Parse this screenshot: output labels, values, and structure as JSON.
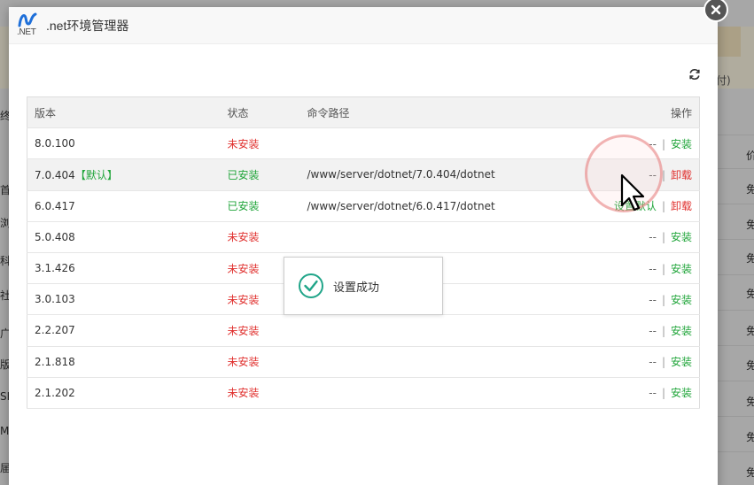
{
  "modal": {
    "title": ".net环境管理器",
    "logo_text": ".NET"
  },
  "background": {
    "paren_text": "付)",
    "left_chars": [
      "终",
      "首",
      "浏",
      "科",
      "社",
      "广",
      "版",
      "SF",
      "M",
      "届"
    ],
    "right_header": "价",
    "right_chars": [
      "免",
      "免",
      "免",
      "免",
      "免",
      "免",
      "免",
      "免",
      "免"
    ]
  },
  "table": {
    "headers": {
      "version": "版本",
      "status": "状态",
      "path": "命令路径",
      "action": "操作"
    },
    "rows": [
      {
        "version": "8.0.100",
        "default_tag": "",
        "status": "未安装",
        "installed": false,
        "path": "",
        "left_action": "--",
        "right_action": "安装"
      },
      {
        "version": "7.0.404",
        "default_tag": "【默认】",
        "status": "已安装",
        "installed": true,
        "path": "/www/server/dotnet/7.0.404/dotnet",
        "left_action": "--",
        "right_action": "卸载"
      },
      {
        "version": "6.0.417",
        "default_tag": "",
        "status": "已安装",
        "installed": true,
        "path": "/www/server/dotnet/6.0.417/dotnet",
        "left_action": "设置默认",
        "right_action": "卸载"
      },
      {
        "version": "5.0.408",
        "default_tag": "",
        "status": "未安装",
        "installed": false,
        "path": "",
        "left_action": "--",
        "right_action": "安装"
      },
      {
        "version": "3.1.426",
        "default_tag": "",
        "status": "未安装",
        "installed": false,
        "path": "",
        "left_action": "--",
        "right_action": "安装"
      },
      {
        "version": "3.0.103",
        "default_tag": "",
        "status": "未安装",
        "installed": false,
        "path": "",
        "left_action": "--",
        "right_action": "安装"
      },
      {
        "version": "2.2.207",
        "default_tag": "",
        "status": "未安装",
        "installed": false,
        "path": "",
        "left_action": "--",
        "right_action": "安装"
      },
      {
        "version": "2.1.818",
        "default_tag": "",
        "status": "未安装",
        "installed": false,
        "path": "",
        "left_action": "--",
        "right_action": "安装"
      },
      {
        "version": "2.1.202",
        "default_tag": "",
        "status": "未安装",
        "installed": false,
        "path": "",
        "left_action": "--",
        "right_action": "安装"
      }
    ]
  },
  "toast": {
    "message": "设置成功"
  },
  "colors": {
    "success": "#20a53a",
    "danger": "#e0302e",
    "logo": "#1e6fd9"
  }
}
